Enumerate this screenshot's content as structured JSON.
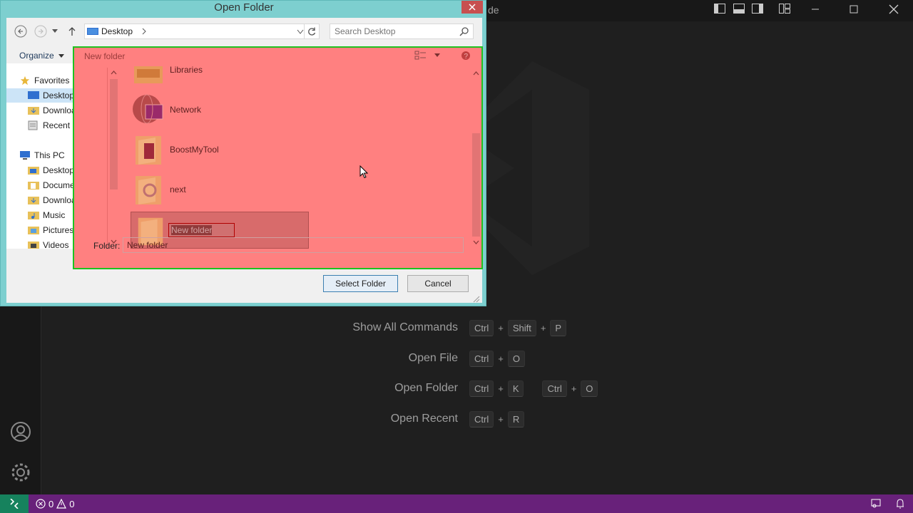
{
  "vscode": {
    "title_fragment": "de",
    "status": {
      "errors": "0",
      "warnings": "0"
    },
    "shortcuts": [
      {
        "label": "Show All Commands",
        "keys": [
          [
            "Ctrl",
            "Shift",
            "P"
          ]
        ]
      },
      {
        "label": "Open File",
        "keys": [
          [
            "Ctrl",
            "O"
          ]
        ]
      },
      {
        "label": "Open Folder",
        "keys": [
          [
            "Ctrl",
            "K"
          ],
          [
            "Ctrl",
            "O"
          ]
        ]
      },
      {
        "label": "Open Recent",
        "keys": [
          [
            "Ctrl",
            "R"
          ]
        ]
      }
    ],
    "colors": {
      "status_bar": "#68217a",
      "remote": "#16825d",
      "background": "#1f1f1f"
    }
  },
  "dialog": {
    "title": "Open Folder",
    "address": "Desktop",
    "search_placeholder": "Search Desktop",
    "organize_label": "Organize",
    "overlay_label": "New folder",
    "nav": {
      "favorites": "Favorites",
      "fav_items": [
        "Desktop",
        "Downloads",
        "Recent places"
      ],
      "this_pc": "This PC",
      "pc_items": [
        "Desktop",
        "Documents",
        "Downloads",
        "Music",
        "Pictures",
        "Videos"
      ]
    },
    "files": [
      "Libraries",
      "Network",
      "BoostMyTool",
      "next"
    ],
    "new_folder_name": "New folder",
    "folder_label": "Folder:",
    "folder_value": "New folder",
    "select_button": "Select Folder",
    "cancel_button": "Cancel",
    "overlay_color": "#ff8080"
  }
}
